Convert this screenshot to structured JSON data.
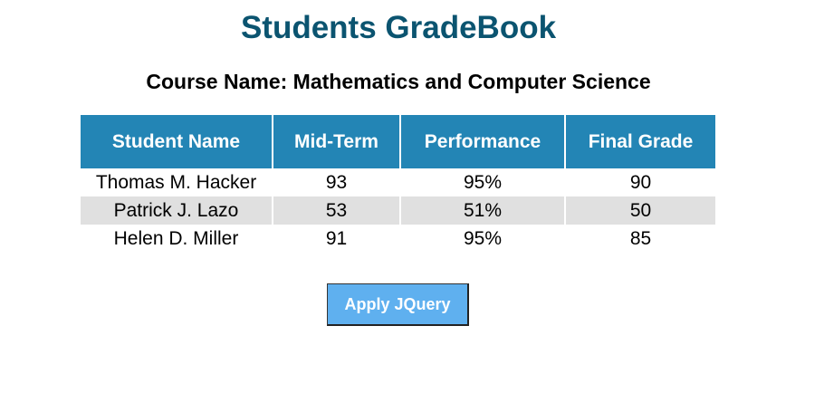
{
  "page": {
    "title": "Students GradeBook",
    "course_name": "Course Name: Mathematics and Computer Science"
  },
  "table": {
    "headers": [
      "Student Name",
      "Mid-Term",
      "Performance",
      "Final Grade"
    ],
    "rows": [
      [
        "Thomas M. Hacker",
        "93",
        "95%",
        "90"
      ],
      [
        "Patrick J. Lazo",
        "53",
        "51%",
        "50"
      ],
      [
        "Helen D. Miller",
        "91",
        "95%",
        "85"
      ]
    ]
  },
  "actions": {
    "apply_label": "Apply JQuery"
  },
  "colors": {
    "title": "#0b5470",
    "header_bg": "#2385b5",
    "row_alt_bg": "#e0e0e0",
    "button_bg": "#5fb0ef"
  }
}
